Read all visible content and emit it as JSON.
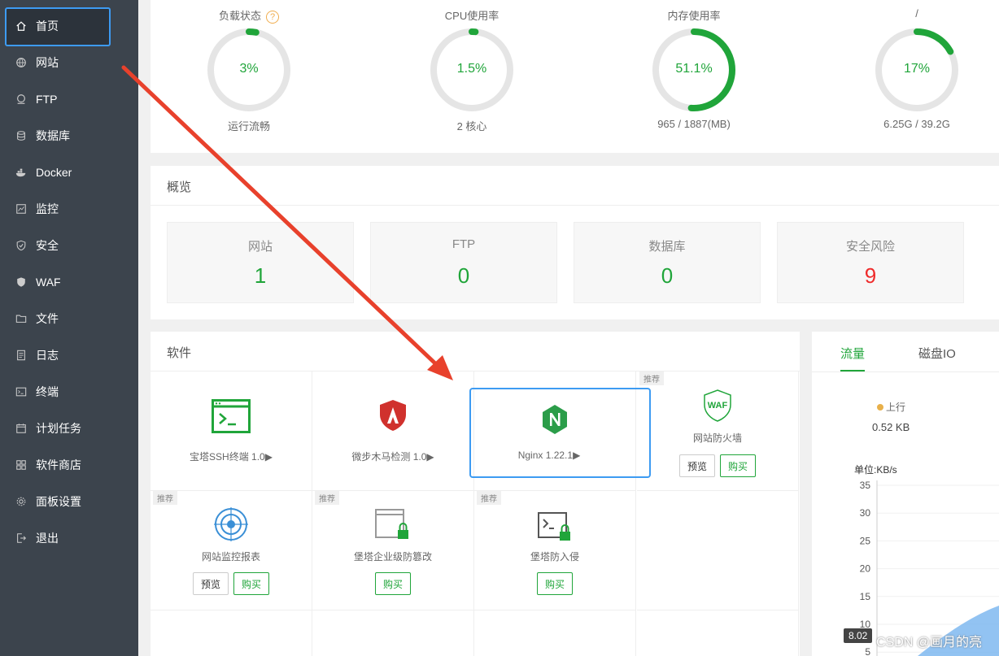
{
  "sidebar": {
    "items": [
      {
        "label": "首页",
        "icon": "home-icon"
      },
      {
        "label": "网站",
        "icon": "globe-icon"
      },
      {
        "label": "FTP",
        "icon": "ftp-icon"
      },
      {
        "label": "数据库",
        "icon": "database-icon"
      },
      {
        "label": "Docker",
        "icon": "docker-icon"
      },
      {
        "label": "监控",
        "icon": "monitor-icon"
      },
      {
        "label": "安全",
        "icon": "shield-icon"
      },
      {
        "label": "WAF",
        "icon": "waf-shield-icon"
      },
      {
        "label": "文件",
        "icon": "folder-icon"
      },
      {
        "label": "日志",
        "icon": "log-icon"
      },
      {
        "label": "终端",
        "icon": "terminal-icon"
      },
      {
        "label": "计划任务",
        "icon": "calendar-icon"
      },
      {
        "label": "软件商店",
        "icon": "apps-grid-icon"
      },
      {
        "label": "面板设置",
        "icon": "gear-icon"
      },
      {
        "label": "退出",
        "icon": "logout-icon"
      }
    ]
  },
  "gauges": [
    {
      "title": "负载状态",
      "value": "3%",
      "percent": 3,
      "sub": "运行流畅",
      "help": "?"
    },
    {
      "title": "CPU使用率",
      "value": "1.5%",
      "percent": 1.5,
      "sub": "2 核心"
    },
    {
      "title": "内存使用率",
      "value": "51.1%",
      "percent": 51.1,
      "sub": "965 / 1887(MB)"
    },
    {
      "title": "/",
      "value": "17%",
      "percent": 17,
      "sub": "6.25G / 39.2G"
    }
  ],
  "overview": {
    "title": "概览",
    "cards": [
      {
        "label": "网站",
        "value": "1"
      },
      {
        "label": "FTP",
        "value": "0"
      },
      {
        "label": "数据库",
        "value": "0"
      },
      {
        "label": "安全风险",
        "value": "9"
      }
    ]
  },
  "software": {
    "title": "软件",
    "tag": "推荐",
    "preview_label": "预览",
    "buy_label": "购买",
    "items": [
      {
        "name": "宝塔SSH终端 1.0▶"
      },
      {
        "name": "微步木马检测 1.0▶"
      },
      {
        "name": "Nginx 1.22.1▶"
      },
      {
        "name": "网站防火墙"
      },
      {
        "name": "网站监控报表"
      },
      {
        "name": "堡塔企业级防篡改"
      },
      {
        "name": "堡塔防入侵"
      }
    ]
  },
  "traffic": {
    "tabs": [
      "流量",
      "磁盘IO"
    ],
    "up_label": "上行",
    "up_value": "0.52 KB",
    "unit": "单位:KB/s",
    "y_ticks": [
      "35",
      "30",
      "25",
      "20",
      "15",
      "10",
      "5"
    ],
    "tooltip": "8.02"
  },
  "watermark": "CSDN @画月的亮",
  "colors": {
    "accent": "#20a53a",
    "danger": "#ef2b2b",
    "sidebar": "#3c444d",
    "highlight": "#3d9bf2",
    "arrow": "#e8412c"
  }
}
